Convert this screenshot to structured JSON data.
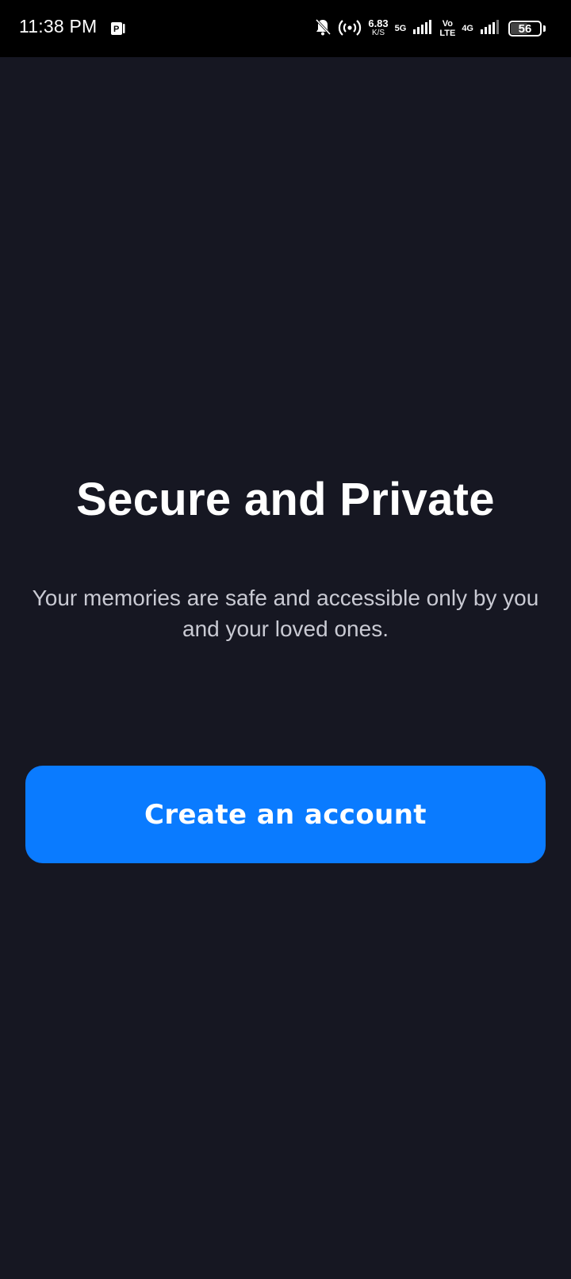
{
  "status_bar": {
    "time": "11:38 PM",
    "speed_value": "6.83",
    "speed_unit": "K/S",
    "network_1": "5G",
    "volte_top": "Vo",
    "volte_bottom": "LTE",
    "network_2": "4G",
    "battery_level": "56",
    "icons": [
      "app-notification-icon",
      "bell-muted-icon",
      "hotspot-icon",
      "signal-icon",
      "signal-icon",
      "battery-icon"
    ]
  },
  "onboarding": {
    "title": "Secure and Private",
    "subtitle": "Your memories are safe and accessible only by you and your loved ones.",
    "cta_label": "Create an account"
  },
  "colors": {
    "background": "#161722",
    "status_bar": "#000000",
    "accent": "#0a7bff",
    "title_text": "#ffffff",
    "subtitle_text": "#c9cad3"
  }
}
